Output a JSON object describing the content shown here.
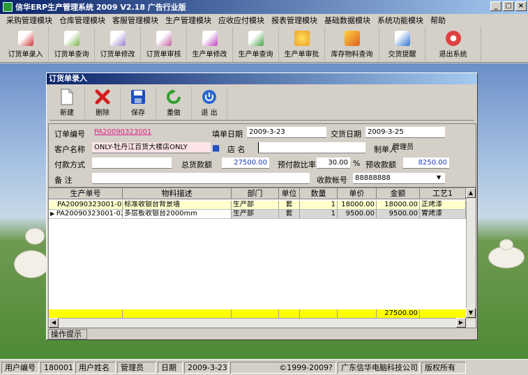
{
  "window": {
    "title": "信华ERP生产管理系统  2009 V2.18 广告行业版",
    "min": "_",
    "max": "□",
    "close": "×"
  },
  "menu": [
    "采购管理模块",
    "仓库管理模块",
    "客服管理模块",
    "生产管理模块",
    "应收应付模块",
    "报表管理模块",
    "基础数据模块",
    "系统功能模块",
    "帮助"
  ],
  "toolbar": [
    {
      "label": "订货单录入",
      "icon": "order-entry-icon",
      "color": "#d03030"
    },
    {
      "label": "订货单查询",
      "icon": "order-query-icon",
      "color": "#7ab648"
    },
    {
      "label": "订货单修改",
      "icon": "order-edit-icon",
      "color": "#9a7fd0"
    },
    {
      "label": "订货单审核",
      "icon": "order-audit-icon",
      "color": "#c060a0"
    },
    {
      "label": "生产单修改",
      "icon": "production-edit-icon",
      "color": "#c040c0"
    },
    {
      "label": "生产单查询",
      "icon": "production-query-icon",
      "color": "#40a040"
    },
    {
      "label": "生产单审批",
      "icon": "production-approve-icon",
      "color": "#f0a020"
    },
    {
      "label": "库存物料查询",
      "icon": "inventory-query-icon",
      "color": "#e06020"
    },
    {
      "label": "交货提醒",
      "icon": "delivery-reminder-icon",
      "color": "#3070d0"
    },
    {
      "label": "退出系统",
      "icon": "exit-icon",
      "color": "#e04040"
    }
  ],
  "child": {
    "title": "订货单录入",
    "tools": [
      {
        "label": "新建",
        "icon": "new-document-icon"
      },
      {
        "label": "删除",
        "icon": "delete-x-icon"
      },
      {
        "label": "保存",
        "icon": "save-disk-icon"
      },
      {
        "label": "重做",
        "icon": "redo-icon"
      },
      {
        "label": "退 出",
        "icon": "exit-power-icon"
      }
    ],
    "form": {
      "order_no_label": "订单编号",
      "order_no": "PA20090323001",
      "fill_date_label": "填单日期",
      "fill_date": "2009-3-23",
      "delivery_date_label": "交货日期",
      "delivery_date": "2009-3-25",
      "customer_label": "客户名称",
      "customer": "ONLY-牡丹江百货大楼店ONLY",
      "store_label": "店  名",
      "store": "",
      "creator_label": "制单人",
      "creator": "管理员",
      "payment_label": "付款方式",
      "payment": "",
      "total_label": "总货款额",
      "total": "27500.00",
      "ratio_label": "预付款比率",
      "ratio": "30.00",
      "ratio_unit": "%",
      "prepay_label": "预收款额",
      "prepay": "8250.00",
      "remark_label": "备  注",
      "remark": "",
      "account_label": "收款帐号",
      "account": "88888888"
    },
    "grid": {
      "headers": [
        "生产单号",
        "物料描述",
        "部门",
        "单位",
        "数量",
        "单价",
        "金额",
        "工艺1"
      ],
      "rows": [
        [
          "PA20090323001-01",
          "标准收银台背景墙",
          "生产部",
          "套",
          "1",
          "18000.00",
          "18000.00",
          "正烤漆"
        ],
        [
          "PA20090323001-02",
          "多层板收银台2000mm",
          "生产部",
          "套",
          "1",
          "9500.00",
          "9500.00",
          "胃烤漆"
        ]
      ],
      "total_amount": "27500.00"
    },
    "tip": "操作提示"
  },
  "status": [
    "用户编号",
    "180001",
    "用户姓名",
    "管理员",
    "日期",
    "2009-3-23",
    "©1999-2009?",
    "广东信华电脑科技公司",
    "版权所有"
  ]
}
